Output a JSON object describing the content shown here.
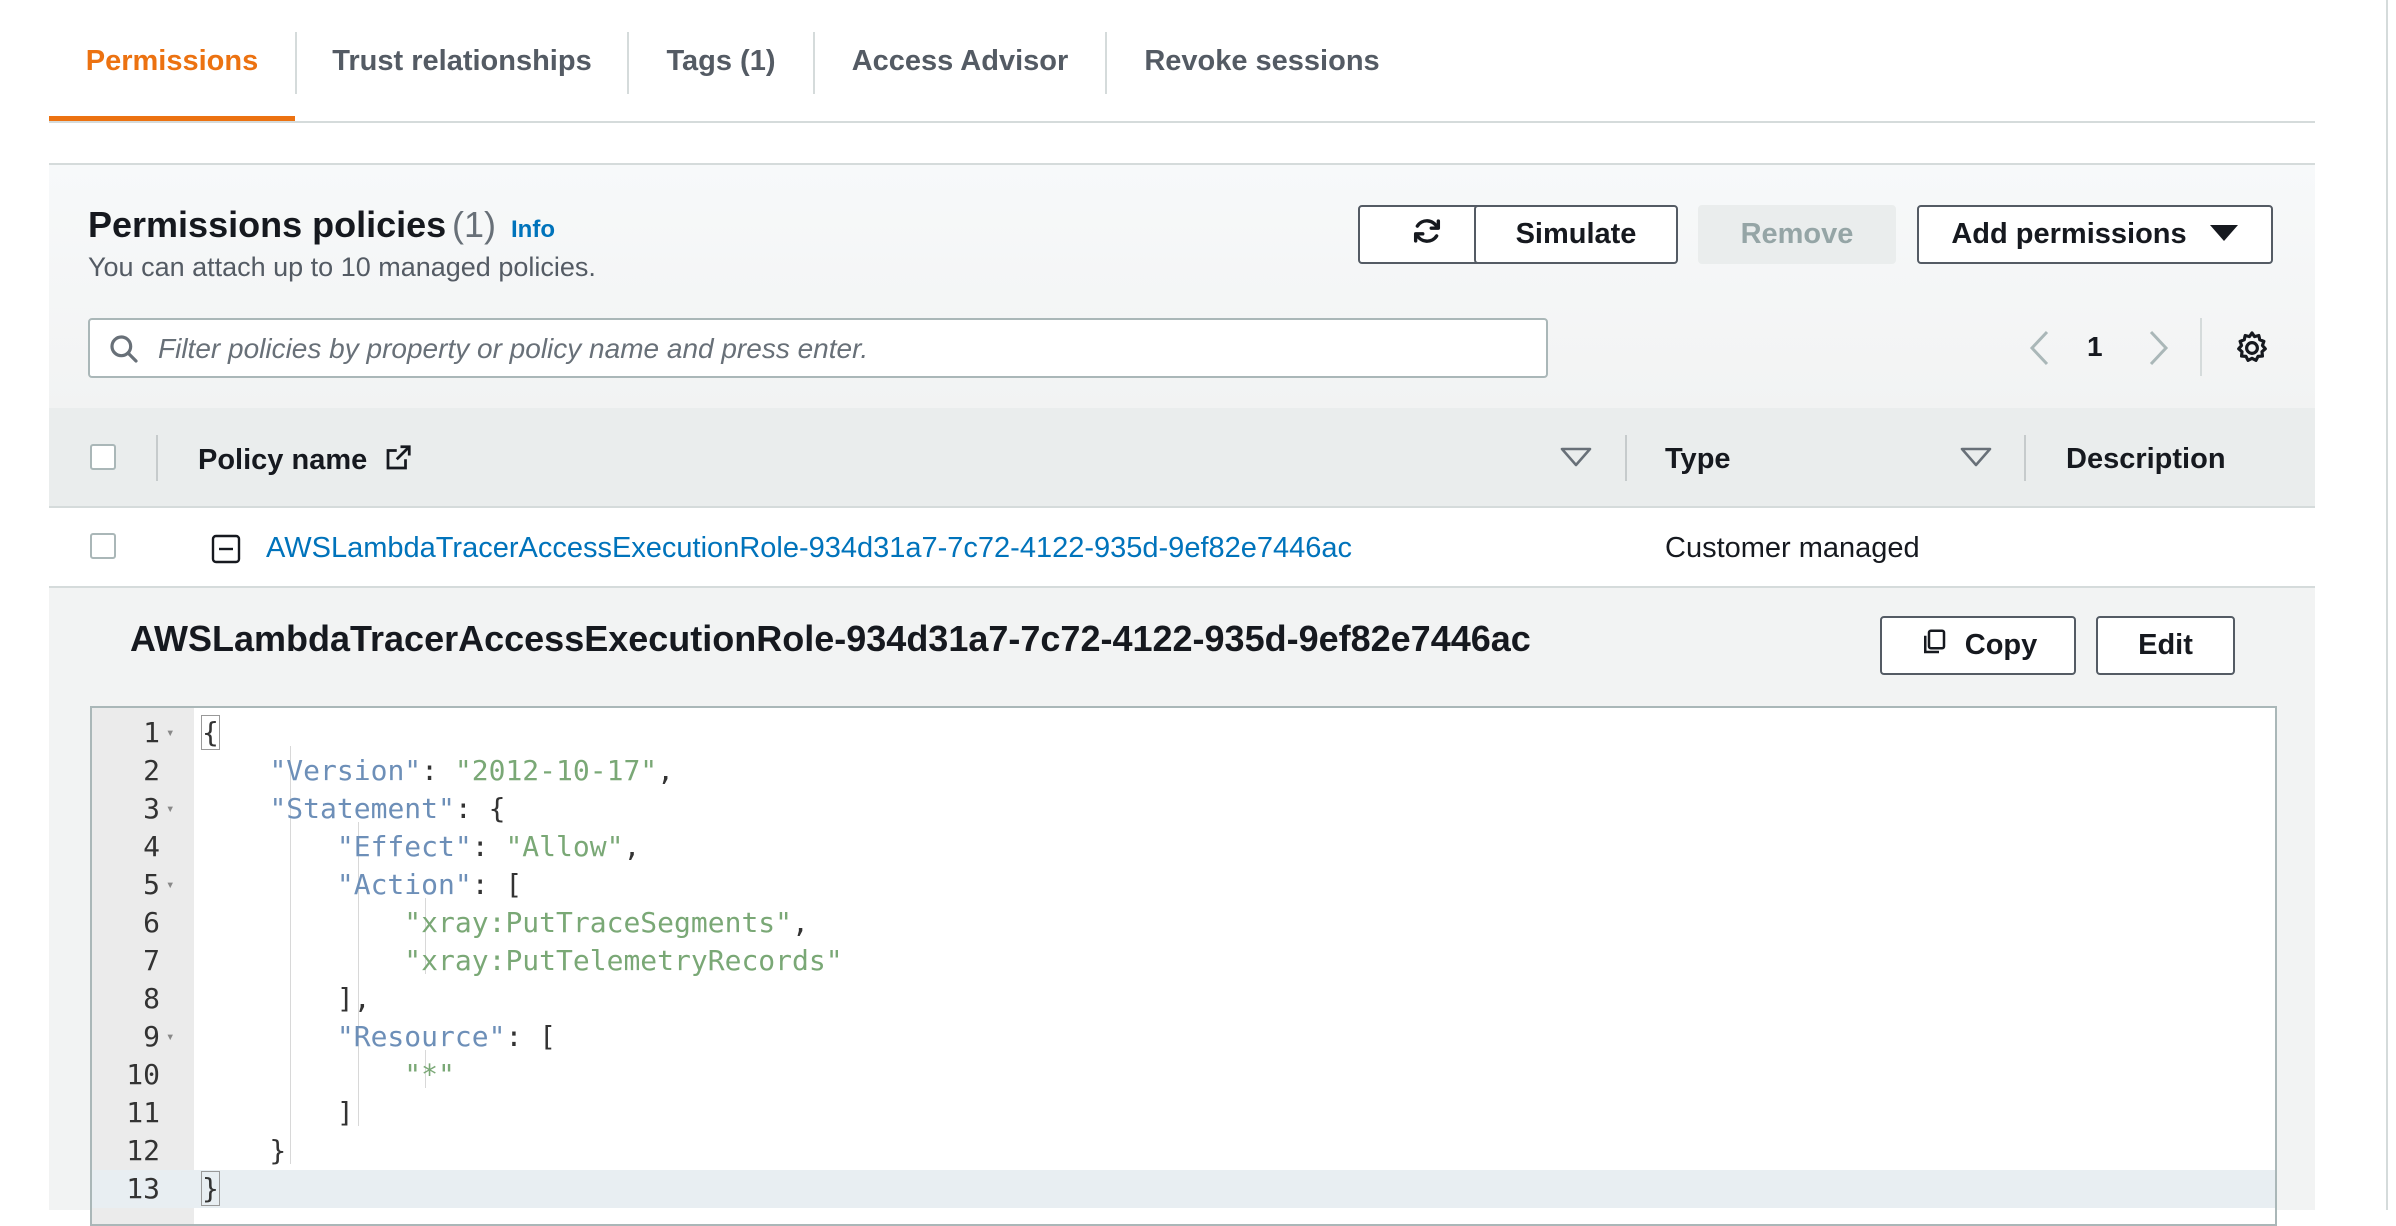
{
  "tabs": [
    {
      "label": "Permissions",
      "active": true
    },
    {
      "label": "Trust relationships",
      "active": false
    },
    {
      "label": "Tags (1)",
      "active": false
    },
    {
      "label": "Access Advisor",
      "active": false
    },
    {
      "label": "Revoke sessions",
      "active": false
    }
  ],
  "policies": {
    "title": "Permissions policies",
    "count": "(1)",
    "info": "Info",
    "subtitle": "You can attach up to 10 managed policies.",
    "buttons": {
      "refresh_icon": "refresh-icon",
      "simulate": "Simulate",
      "remove": "Remove",
      "add_permissions": "Add permissions"
    },
    "search_placeholder": "Filter policies by property or policy name and press enter.",
    "pagination": {
      "current_page": "1"
    },
    "columns": {
      "policy_name": "Policy name",
      "type": "Type",
      "description": "Description"
    },
    "rows": [
      {
        "policy_name": "AWSLambdaTracerAccessExecutionRole-934d31a7-7c72-4122-935d-9ef82e7446ac",
        "type": "Customer managed",
        "description": "",
        "expanded": true
      }
    ]
  },
  "detail": {
    "title": "AWSLambdaTracerAccessExecutionRole-934d31a7-7c72-4122-935d-9ef82e7446ac",
    "copy": "Copy",
    "edit": "Edit",
    "code_lines": [
      "{",
      "    \"Version\": \"2012-10-17\",",
      "    \"Statement\": {",
      "        \"Effect\": \"Allow\",",
      "        \"Action\": [",
      "            \"xray:PutTraceSegments\",",
      "            \"xray:PutTelemetryRecords\"",
      "        ],",
      "        \"Resource\": [",
      "            \"*\"",
      "        ]",
      "    }",
      "}"
    ]
  },
  "colors": {
    "accent": "#ec7211",
    "link": "#0073bb",
    "json_key": "#6d8fb8",
    "json_string": "#7aa876"
  }
}
